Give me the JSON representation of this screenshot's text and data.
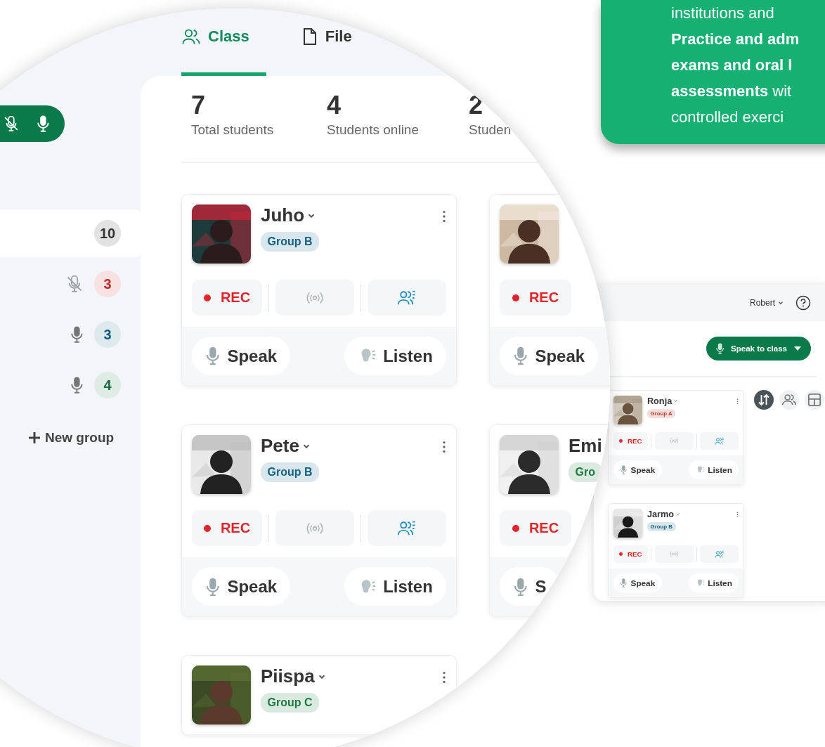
{
  "callout": {
    "lines": [
      "institutions and",
      "**Practice and adm**",
      "**exams and oral l**",
      "**assessments** wit",
      "controlled exerci"
    ]
  },
  "sidebar": {
    "mic_toggle_on": true,
    "groups": [
      {
        "kind": "all",
        "count": "10",
        "selected": true,
        "color": "#333333"
      },
      {
        "kind": "muted",
        "count": "3",
        "selected": false,
        "color": "#c62828"
      },
      {
        "kind": "mic",
        "count": "3",
        "selected": false,
        "color": "#0f5f80"
      },
      {
        "kind": "mic",
        "count": "4",
        "selected": false,
        "color": "#1b6e43"
      }
    ],
    "new_group": "New group"
  },
  "tabs": [
    {
      "kind": "class",
      "label": "Class",
      "selected": true
    },
    {
      "kind": "files",
      "label": "File",
      "selected": false
    }
  ],
  "stats": [
    {
      "value": "7",
      "label": "Total students"
    },
    {
      "value": "4",
      "label": "Students online"
    },
    {
      "value": "2",
      "label": "Studen"
    }
  ],
  "cards": [
    {
      "name": "Juho",
      "group": "Group B",
      "color": "#14627f",
      "menu": true,
      "rec": "REC",
      "speak": "Speak",
      "listen": "Listen"
    },
    {
      "rec": "REC",
      "speak": "Speak"
    },
    {
      "name": "Pete",
      "group": "Group B",
      "color": "#14627f",
      "menu": true,
      "rec": "REC",
      "speak": "Speak",
      "listen": "Listen"
    },
    {
      "name": "Emi",
      "group": "Gro",
      "color": "#1d7a46",
      "rec": "REC",
      "speak": "S"
    },
    {
      "name": "Piispa",
      "group": "Group C",
      "color": "#1d7a46",
      "menu": true
    }
  ],
  "panel": {
    "user": "Robert",
    "speak_button": "Speak to class",
    "views": [
      {
        "kind": "sort",
        "selected": true
      },
      {
        "kind": "groups",
        "selected": false
      },
      {
        "kind": "grid",
        "selected": false
      }
    ],
    "cards": [
      {
        "name": "Ronja",
        "group": "Group A",
        "color": "#c0392b",
        "menu": true,
        "rec": "REC",
        "speak": "Speak",
        "listen": "Listen"
      },
      {
        "name": "Jarmo",
        "group": "Group B",
        "color": "#14627f",
        "menu": true,
        "rec": "REC",
        "speak": "Speak",
        "listen": "Listen"
      }
    ]
  }
}
